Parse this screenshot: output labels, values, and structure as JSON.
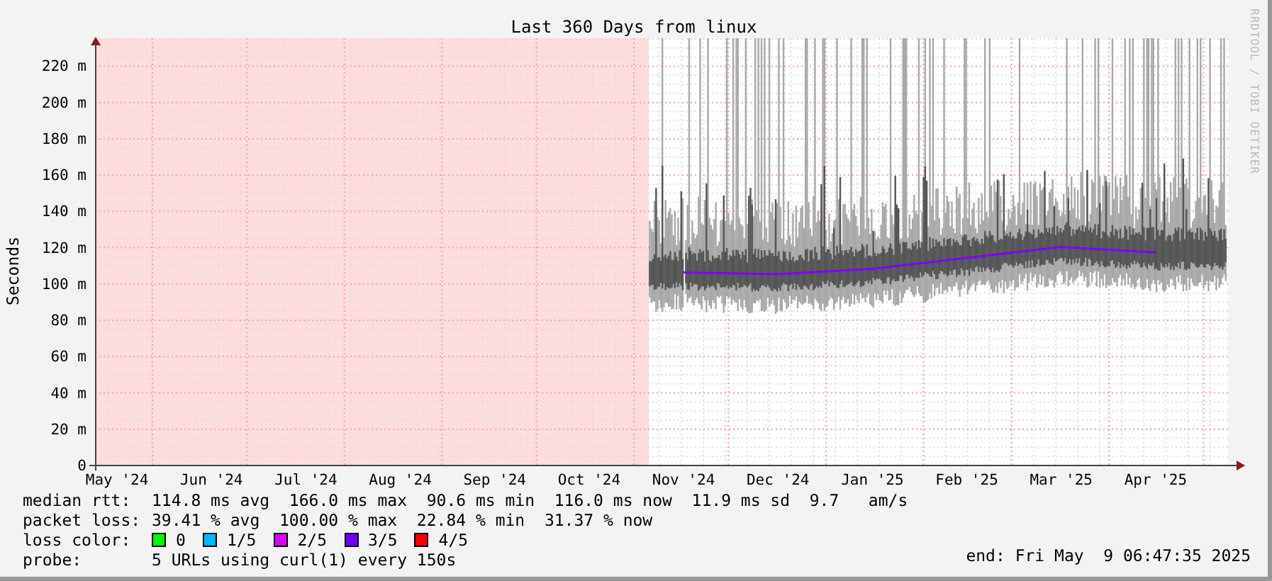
{
  "chart_data": {
    "type": "line",
    "title": "Last 360 Days from linux",
    "ylabel": "Seconds",
    "grid": true,
    "ylim": [
      0,
      235
    ],
    "yticks": [
      {
        "value": 0,
        "label": "0"
      },
      {
        "value": 20,
        "label": "20 m"
      },
      {
        "value": 40,
        "label": "40 m"
      },
      {
        "value": 60,
        "label": "60 m"
      },
      {
        "value": 80,
        "label": "80 m"
      },
      {
        "value": 100,
        "label": "100 m"
      },
      {
        "value": 120,
        "label": "120 m"
      },
      {
        "value": 140,
        "label": "140 m"
      },
      {
        "value": 160,
        "label": "160 m"
      },
      {
        "value": 180,
        "label": "180 m"
      },
      {
        "value": 200,
        "label": "200 m"
      },
      {
        "value": 220,
        "label": "220 m"
      }
    ],
    "categories": [
      "May '24",
      "Jun '24",
      "Jul '24",
      "Aug '24",
      "Sep '24",
      "Oct '24",
      "Nov '24",
      "Dec '24",
      "Jan '25",
      "Feb '25",
      "Mar '25",
      "Apr '25"
    ],
    "series": [
      {
        "color": "#7f00ff",
        "values": [
          null,
          null,
          null,
          null,
          null,
          null,
          106,
          105,
          108,
          114,
          120,
          117
        ]
      }
    ]
  },
  "credit": "RRDTOOL / TOBI OETIKER",
  "legend": [
    {
      "kind": "stats",
      "label": "median rtt:",
      "text": "114.8 ms avg  166.0 ms max  90.6 ms min  116.0 ms now  11.9 ms sd  9.7   am/s"
    },
    {
      "kind": "stats",
      "label": "packet loss:",
      "text": "39.41 % avg  100.00 % max  22.84 % min  31.37 % now"
    },
    {
      "kind": "colors",
      "label": "loss color:",
      "items": [
        {
          "label": "0",
          "color": "#00ff00"
        },
        {
          "label": "1/5",
          "color": "#00b8ff"
        },
        {
          "label": "2/5",
          "color": "#e000ff"
        },
        {
          "label": "3/5",
          "color": "#7000ff"
        },
        {
          "label": "4/5",
          "color": "#ff0000"
        }
      ]
    },
    {
      "kind": "stats",
      "label": "probe:",
      "text": "5 URLs using curl(1) every 150s"
    }
  ],
  "end": "end: Fri May  9 06:47:35 2025"
}
